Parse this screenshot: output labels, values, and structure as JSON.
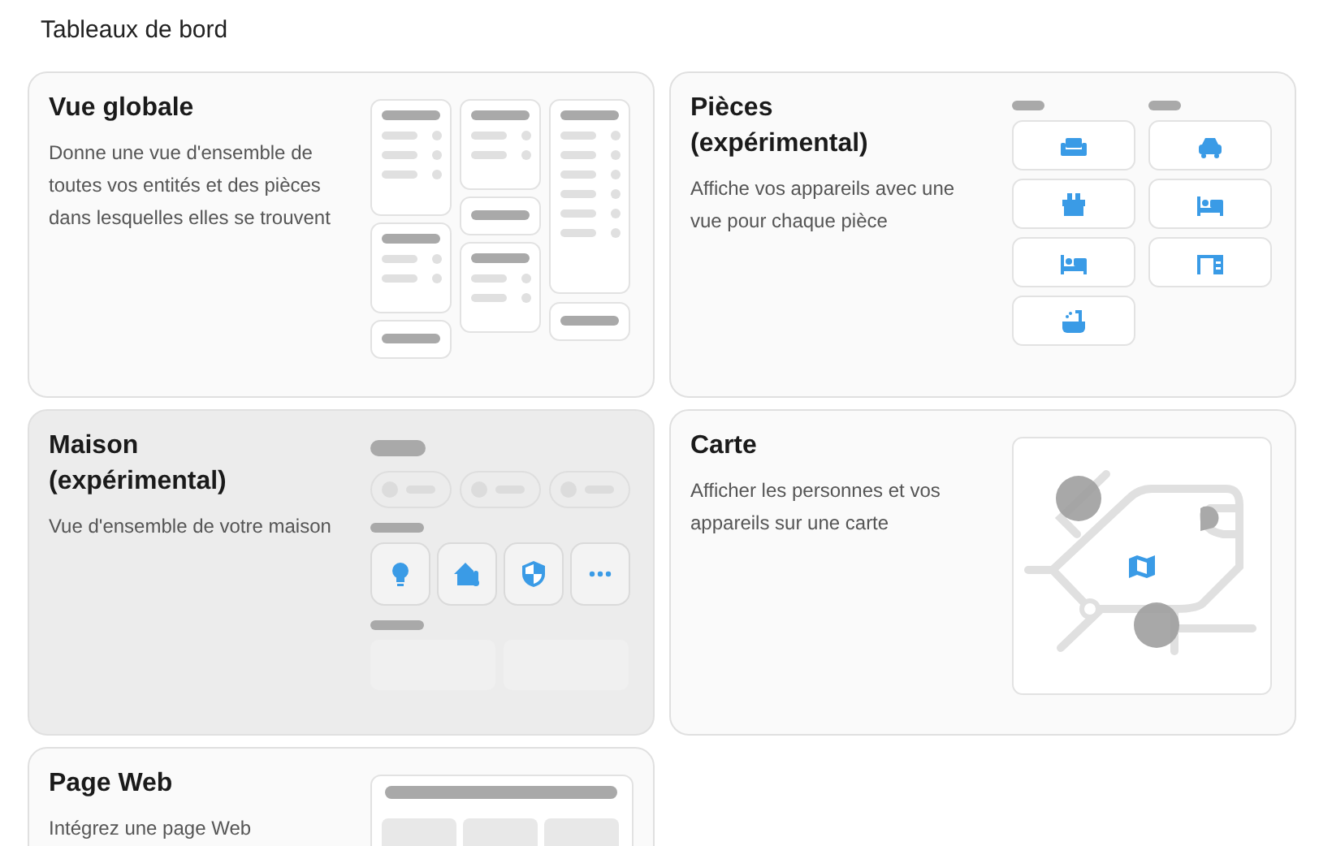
{
  "page_title": "Tableaux de bord",
  "cards": [
    {
      "kind": "overview",
      "title": "Vue globale",
      "description": "Donne une vue d'ensemble de toutes vos entités et des pièces dans lesquelles elles se trouvent",
      "selected": false
    },
    {
      "kind": "rooms",
      "title": "Pièces (expérimental)",
      "description": "Affiche vos appareils avec une vue pour chaque pièce",
      "selected": false
    },
    {
      "kind": "home",
      "title": "Maison (expérimental)",
      "description": "Vue d'ensemble de votre maison",
      "selected": true
    },
    {
      "kind": "map",
      "title": "Carte",
      "description": "Afficher les personnes et vos appareils sur une carte",
      "selected": false
    },
    {
      "kind": "webpage",
      "title": "Page Web",
      "description": "Intégrez une page Web",
      "selected": false
    }
  ]
}
